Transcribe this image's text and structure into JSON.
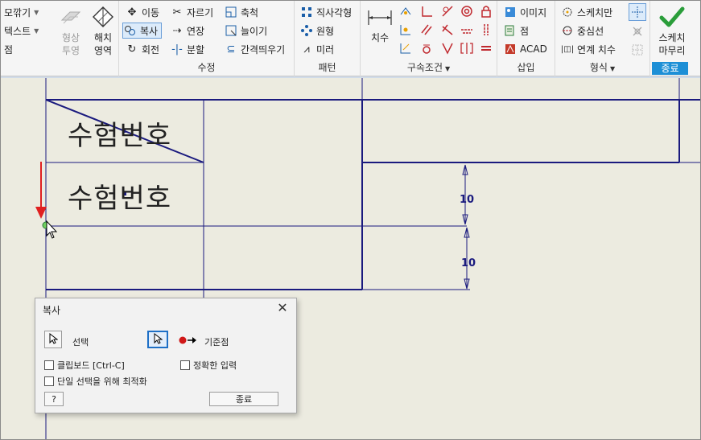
{
  "ribbon": {
    "format_group": {
      "items": [
        "모깎기",
        "텍스트",
        "점"
      ],
      "hatch_large": [
        "형상",
        "투영"
      ],
      "hatch_large2": [
        "해치",
        "영역"
      ]
    },
    "modify_group": {
      "title": "수정",
      "items": [
        "이동",
        "자르기",
        "축척",
        "복사",
        "연장",
        "늘이기",
        "회전",
        "분할",
        "간격띄우기"
      ]
    },
    "pattern_group": {
      "title": "패턴",
      "items": [
        "직사각형",
        "원형",
        "미러"
      ]
    },
    "constraint_group": {
      "title": "구속조건",
      "dimension_label": "치수"
    },
    "insert_group": {
      "title": "삽입",
      "items": [
        "이미지",
        "점",
        "ACAD"
      ]
    },
    "format2_group": {
      "title": "형식",
      "items": [
        "스케치만",
        "중심선",
        "연계 치수"
      ]
    },
    "exit_group": {
      "title": "종료",
      "finish": [
        "스케치",
        "마무리"
      ]
    }
  },
  "canvas": {
    "cell_text_1": "수험번호",
    "cell_text_2": "수험번호",
    "dim_1": "10",
    "dim_2": "10"
  },
  "dialog": {
    "title": "복사",
    "select_label": "선택",
    "base_point_label": "기준점",
    "clipboard_label": "클립보드 [Ctrl-C]",
    "precise_input_label": "정확한 입력",
    "optimize_label": "단일 선택을 위해 최적화",
    "close_button": "종료",
    "help_label": "?"
  },
  "colors": {
    "line": "#1a1a7e",
    "canvas_bg": "#ecebe0",
    "accent_green": "#2a9d3a",
    "exit_blue": "#1d8fd6",
    "arrow_red": "#e02020"
  }
}
